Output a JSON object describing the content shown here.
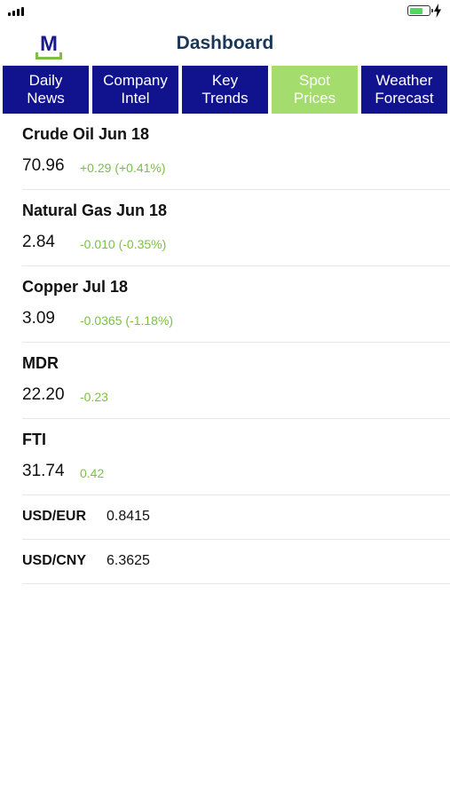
{
  "header": {
    "title": "Dashboard",
    "logo_letter": "M"
  },
  "tabs": [
    {
      "line1": "Daily",
      "line2": "News"
    },
    {
      "line1": "Company",
      "line2": "Intel"
    },
    {
      "line1": "Key",
      "line2": "Trends"
    },
    {
      "line1": "Spot",
      "line2": "Prices",
      "active": true
    },
    {
      "line1": "Weather",
      "line2": "Forecast"
    }
  ],
  "prices": [
    {
      "name": "Crude Oil Jun 18",
      "value": "70.96",
      "change": "+0.29 (+0.41%)"
    },
    {
      "name": "Natural Gas Jun 18",
      "value": "2.84",
      "change": "-0.010 (-0.35%)"
    },
    {
      "name": "Copper Jul 18",
      "value": "3.09",
      "change": "-0.0365 (-1.18%)"
    },
    {
      "name": "MDR",
      "value": "22.20",
      "change": "-0.23"
    },
    {
      "name": "FTI",
      "value": "31.74",
      "change": "0.42"
    }
  ],
  "fx": [
    {
      "name": "USD/EUR",
      "value": "0.8415"
    },
    {
      "name": "USD/CNY",
      "value": "6.3625"
    }
  ],
  "colors": {
    "tab_bg": "#10138d",
    "tab_active_bg": "#a4dc6e",
    "change_text": "#7bc043",
    "title_text": "#1a3658",
    "battery_fill": "#4cd964"
  },
  "status_bar": {
    "battery_level": 0.62,
    "charging": true
  }
}
